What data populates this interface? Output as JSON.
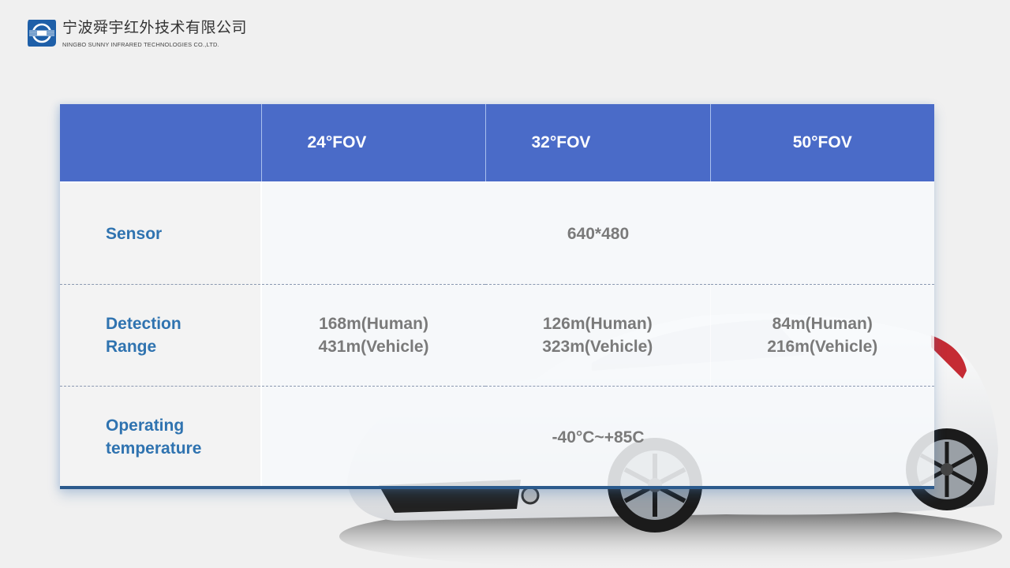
{
  "header": {
    "company_cn": "宁波舜宇红外技术有限公司",
    "company_en": "NINGBO SUNNY INFRARED TECHNOLOGIES CO.,LTD.",
    "logo_icon": "sunny-logo-icon"
  },
  "colors": {
    "header_fill": "#4a6bc8",
    "label_text": "#2f73b0",
    "value_text": "#7a7a7a",
    "accent_bar": "#2b5a8c"
  },
  "table": {
    "columns": [
      "",
      "24°FOV",
      "32°FOV",
      "50°FOV"
    ],
    "rows": [
      {
        "label": "Sensor",
        "values": [
          "640*480"
        ],
        "merged": true
      },
      {
        "label": "Detection Range",
        "label_lines": [
          "Detection",
          "Range"
        ],
        "values": [
          [
            "168m(Human)",
            "431m(Vehicle)"
          ],
          [
            "126m(Human)",
            "323m(Vehicle)"
          ],
          [
            "84m(Human)",
            "216m(Vehicle)"
          ]
        ]
      },
      {
        "label": "Operating temperature",
        "label_lines": [
          "Operating",
          "temperature"
        ],
        "values": [
          "-40°C~+85C"
        ],
        "merged": true
      }
    ]
  },
  "background_image": "white-sedan-car"
}
